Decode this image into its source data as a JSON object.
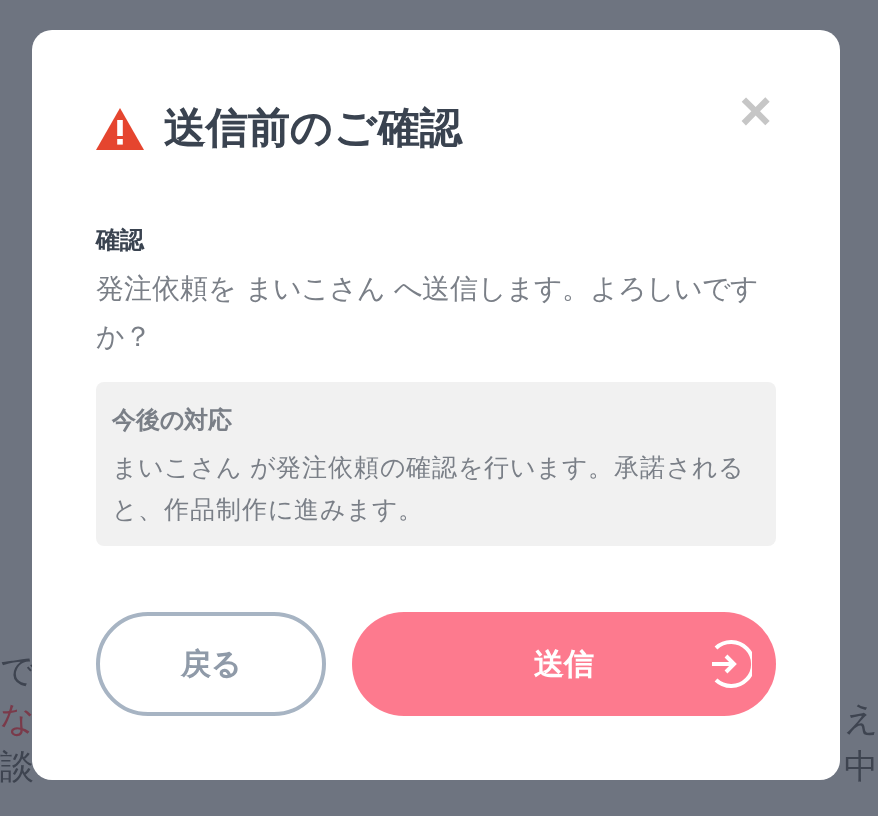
{
  "background": {
    "left_fragments": [
      {
        "text": "で",
        "kind": "normal"
      },
      {
        "text": "な",
        "kind": "alert"
      },
      {
        "text": "談",
        "kind": "normal"
      }
    ],
    "right_fragments": [
      {
        "text": "え",
        "kind": "normal"
      },
      {
        "text": "中",
        "kind": "normal"
      }
    ]
  },
  "dialog": {
    "title": "送信前のご確認",
    "close": "×",
    "section_label": "確認",
    "message": "発注依頼を まいこさん へ送信します。よろしいですか？",
    "info": {
      "title": "今後の対応",
      "text": "まいこさん が発注依頼の確認を行います。承諾されると、作品制作に進みます。"
    },
    "buttons": [
      {
        "label": "戻る",
        "kind": "secondary"
      },
      {
        "label": "送信",
        "kind": "primary"
      }
    ]
  }
}
